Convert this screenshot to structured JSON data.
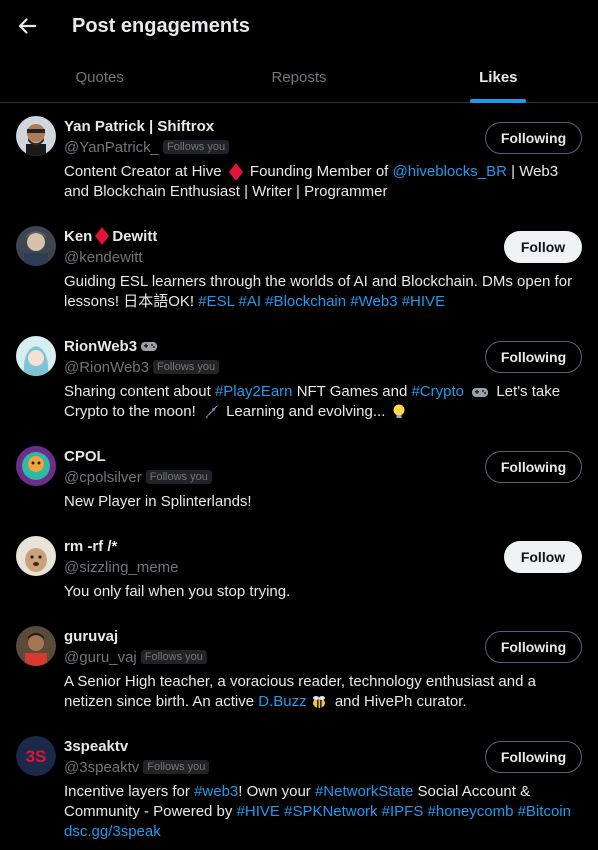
{
  "header": {
    "title": "Post engagements"
  },
  "tabs": [
    {
      "label": "Quotes",
      "active": false
    },
    {
      "label": "Reposts",
      "active": false
    },
    {
      "label": "Likes",
      "active": true
    }
  ],
  "follows_you_label": "Follows you",
  "users": [
    {
      "name": "Yan Patrick | Shiftrox",
      "handle": "@YanPatrick_",
      "follows_you": true,
      "button": "Following",
      "bio": {
        "t1": "Content Creator at Hive",
        "t2": "Founding Member of",
        "link1": "@hiveblocks_BR",
        "t3": "| Web3 and Blockchain Enthusiast | Writer | Programmer"
      }
    },
    {
      "name_a": "Ken",
      "name_b": "Dewitt",
      "handle": "@kendewitt",
      "follows_you": false,
      "button": "Follow",
      "bio": {
        "t1": "Guiding ESL learners through the worlds of AI and Blockchain. DMs open for lessons! 日本語OK!",
        "tags": [
          "#ESL",
          "#AI",
          "#Blockchain",
          "#Web3",
          "#HIVE"
        ]
      }
    },
    {
      "name": "RionWeb3",
      "handle": "@RionWeb3",
      "follows_you": true,
      "button": "Following",
      "bio": {
        "t1": "Sharing content about",
        "link1": "#Play2Earn",
        "t2": "NFT Games and",
        "link2": "#Crypto",
        "t3": "Let's take Crypto to the moon!",
        "t4": "Learning and evolving..."
      }
    },
    {
      "name": "CPOL",
      "handle": "@cpolsilver",
      "follows_you": true,
      "button": "Following",
      "bio": {
        "t1": "New Player in Splinterlands!"
      }
    },
    {
      "name": "rm -rf /*",
      "handle": "@sizzling_meme",
      "follows_you": false,
      "button": "Follow",
      "bio": {
        "t1": "You only fail when you stop trying."
      }
    },
    {
      "name": "guruvaj",
      "handle": "@guru_vaj",
      "follows_you": true,
      "button": "Following",
      "bio": {
        "t1": "A Senior High teacher, a voracious reader, technology enthusiast and a netizen since birth. An active",
        "link1": "D.Buzz",
        "t2": "and HivePh curator."
      }
    },
    {
      "name": "3speaktv",
      "handle": "@3speaktv",
      "follows_you": true,
      "button": "Following",
      "bio": {
        "t1": "Incentive layers for",
        "link1": "#web3",
        "t2": "! Own your",
        "link2": "#NetworkState",
        "t3": "Social Account & Community - Powered by",
        "tags": [
          "#HIVE",
          "#SPKNetwork",
          "#IPFS",
          "#honeycomb",
          "#Bitcoin"
        ],
        "link3": "dsc.gg/3speak"
      }
    }
  ],
  "colors": {
    "accent": "#1d9bf0",
    "hive_red": "#e31337"
  }
}
